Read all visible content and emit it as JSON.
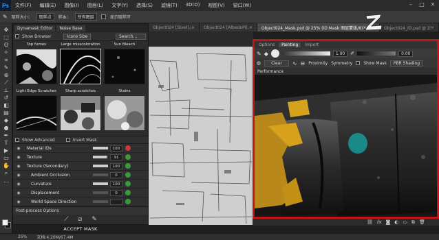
{
  "app": {
    "logo": "Ps",
    "menu": [
      "文件(F)",
      "编辑(E)",
      "图像(I)",
      "图层(L)",
      "文字(Y)",
      "选择(S)",
      "滤镜(T)",
      "3D(D)",
      "视图(V)",
      "窗口(W)"
    ],
    "window_controls": [
      "minimize-icon",
      "maximize-icon",
      "close-icon"
    ]
  },
  "options_bar": {
    "tool_icon": "eyedropper-icon",
    "sample_size_label": "取样大小：",
    "sample_size_value": "取样点",
    "sample_label": "样本：",
    "sample_value": "所有图层",
    "show_ring_label": "显示取样环"
  },
  "tabs": [
    {
      "label": "Object024 [Steel].psd",
      "active": false
    },
    {
      "label": "Object024 [AlbedoM].psd",
      "active": false
    },
    {
      "label": "Object024_Mask.psd @ 25% (ID Mask 图层蒙版/8)",
      "active": true
    },
    {
      "label": "Object024_ID.psd @ 25% (图层...",
      "active": false
    }
  ],
  "dynamask": {
    "tabs": [
      "Dynamask Editor",
      "Noise Base"
    ],
    "show_browser_label": "Show Browser",
    "icon_size_label": "Icons Size",
    "search_label": "Search...",
    "thumbnails": [
      {
        "label": "Top fumes",
        "selected": false
      },
      {
        "label": "Large misscoloration",
        "selected": true
      },
      {
        "label": "Sun Bleach",
        "selected": false
      },
      {
        "label": "Light Edge Scratches",
        "selected": false
      },
      {
        "label": "Sharp scratches",
        "selected": false
      },
      {
        "label": "Stains",
        "selected": false
      }
    ],
    "show_advanced_label": "Show Advanced",
    "invert_mask_label": "Invert Mask",
    "layers": [
      {
        "name": "Material IDs",
        "value": "100",
        "fill": 1.0,
        "color": "#c83a3a",
        "indent": false
      },
      {
        "name": "Texture",
        "value": "91",
        "fill": 0.91,
        "color": "#3a9a3a",
        "indent": false
      },
      {
        "name": "Texture (Secondary)",
        "value": "100",
        "fill": 1.0,
        "color": "#3a9a3a",
        "indent": false
      },
      {
        "name": "Ambient Occlusion",
        "value": "0",
        "fill": 0.0,
        "color": "#3a9a3a",
        "indent": true
      },
      {
        "name": "Curvature",
        "value": "100",
        "fill": 1.0,
        "color": "#3a9a3a",
        "indent": true
      },
      {
        "name": "Displacement",
        "value": "0",
        "fill": 0.0,
        "color": "#3a9a3a",
        "indent": true
      },
      {
        "name": "World Space Direction",
        "value": "",
        "fill": 0.0,
        "color": "#3a9a3a",
        "indent": true
      }
    ],
    "postprocess_label": "Post-process Options",
    "accept_label": "ACCEPT MASK"
  },
  "viewport": {
    "tabs": [
      "Options",
      "Painting",
      "Import"
    ],
    "active_tab": "Painting",
    "opacity_value": "1.00",
    "hardness_value": "0.00",
    "clear_label": "Clear",
    "proximity_label": "Proximity",
    "symmetry_label": "Symmetry",
    "show_mask_label": "Show Mask",
    "shading_label": "PBR Shading",
    "performance_label": "Performance"
  },
  "status": {
    "zoom": "25%",
    "doc_info": "文档:4.20M/67.4M"
  },
  "colors": {
    "accent_red": "#c01616",
    "ps_blue": "#31a8ff",
    "yellow_part": "#d6a21c",
    "teal_spot": "#1a9a9a"
  }
}
